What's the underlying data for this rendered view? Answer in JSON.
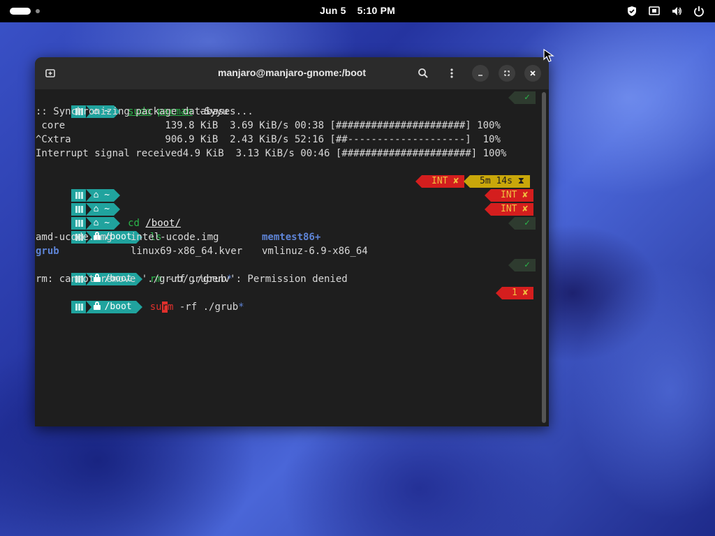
{
  "topbar": {
    "date": "Jun 5",
    "time": "5:10 PM"
  },
  "window": {
    "title": "manjaro@manjaro-gnome:/boot"
  },
  "icons": {
    "new_tab": "new-tab-icon",
    "search": "search-icon",
    "menu": "kebab-menu-icon",
    "minimize": "minimize-icon",
    "maximize": "maximize-icon",
    "close": "close-icon"
  },
  "prompt": {
    "home": "~",
    "boot": "/boot"
  },
  "lines": {
    "l1_cmd_sudo": "sudo",
    "l1_cmd_pacman": "pacman",
    "l1_cmd_args": " -Syyu",
    "l1_status": "✓",
    "l2": ":: Synchronizing package databases...",
    "l3": " core                 139.8 KiB  3.69 KiB/s 00:38 [######################] 100%",
    "l4": "^Cxtra                906.9 KiB  2.43 KiB/s 52:16 [##--------------------]  10%",
    "l5": "Interrupt signal received4.9 KiB  3.13 KiB/s 00:46 [######################] 100%",
    "l7_int": "INT ✘",
    "l7_dur": "5m 14s ⧗",
    "l8_int": "INT ✘",
    "l9_cmd": "cd",
    "l9_path": "/boot/",
    "l9_int": "INT ✘",
    "l10_cmd": "ls",
    "l10_status": "✓",
    "l11_c1": "amd-ucode.img",
    "l11_c2": "intel-ucode.img",
    "l11_c3": "memtest86+",
    "l12_c1": "grub",
    "l12_c2": "linux69-x86_64.kver",
    "l12_c3": "vmlinuz-6.9-x86_64",
    "l13_cmd": "rm",
    "l13_args": " -rf ./grub",
    "l13_glob": "*",
    "l13_status": "✓",
    "l14": "rm: cannot remove './grub/grubenv': Permission denied",
    "l15_cmd_a": "su",
    "l15_cursor": "r",
    "l15_cmd_b": "m",
    "l15_args": " -rf ./grub",
    "l15_glob": "*",
    "l15_err": "1 ✘"
  },
  "colors": {
    "prompt_teal": "#20a39e",
    "ok_green": "#2bb64a",
    "error_red": "#d41e1e",
    "duration_yellow": "#c9a70a",
    "dir_blue": "#5e84d6"
  }
}
